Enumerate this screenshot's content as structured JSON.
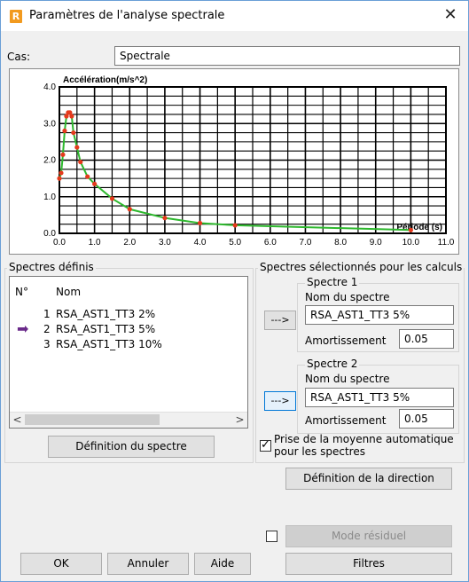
{
  "window": {
    "title": "Paramètres de l'analyse spectrale",
    "app_icon_letter": "R",
    "close_glyph": "✕"
  },
  "case": {
    "label": "Cas:",
    "value": "Spectrale"
  },
  "chart_data": {
    "type": "scatter",
    "title": "",
    "ylabel": "Accélération(m/s^2)",
    "xlabel": "Période (s)",
    "xlim": [
      0.0,
      11.0
    ],
    "ylim": [
      0.0,
      4.0
    ],
    "x_ticks": [
      "0.0",
      "1.0",
      "2.0",
      "3.0",
      "4.0",
      "5.0",
      "6.0",
      "7.0",
      "8.0",
      "9.0",
      "10.0",
      "11.0"
    ],
    "y_ticks": [
      "0.0",
      "1.0",
      "2.0",
      "3.0",
      "4.0"
    ],
    "grid": true,
    "series": [
      {
        "x": [
          0.0,
          0.05,
          0.1,
          0.15,
          0.2,
          0.25,
          0.3,
          0.35,
          0.4,
          0.5,
          0.6,
          0.8,
          1.0,
          1.5,
          2.0,
          3.0,
          4.0,
          5.0,
          10.0
        ],
        "y": [
          1.5,
          1.65,
          2.15,
          2.8,
          3.2,
          3.3,
          3.3,
          3.2,
          2.75,
          2.35,
          1.95,
          1.55,
          1.35,
          0.95,
          0.66,
          0.42,
          0.28,
          0.22,
          0.09
        ],
        "line_color": "#2eb82e",
        "marker_color": "#e53a1c"
      }
    ]
  },
  "left_panel": {
    "title": "Spectres définis",
    "columns": {
      "num": "N°",
      "name": "Nom"
    },
    "rows": [
      {
        "num": "1",
        "name": "RSA_AST1_TT3 2%",
        "selected": false
      },
      {
        "num": "2",
        "name": "RSA_AST1_TT3 5%",
        "selected": true
      },
      {
        "num": "3",
        "name": "RSA_AST1_TT3 10%",
        "selected": false
      }
    ],
    "scroll_left": "<",
    "scroll_right": ">",
    "definition_button": "Définition du spectre"
  },
  "right_panel": {
    "title": "Spectres sélectionnés pour les calculs",
    "spectre1": {
      "title": "Spectre 1",
      "name_label": "Nom du spectre",
      "name": "RSA_AST1_TT3 5%",
      "damping_label": "Amortissement",
      "damping": "0.05",
      "arrow": "--->"
    },
    "spectre2": {
      "title": "Spectre 2",
      "name_label": "Nom du spectre",
      "name": "RSA_AST1_TT3 5%",
      "damping_label": "Amortissement",
      "damping": "0.05",
      "arrow": "--->"
    },
    "average_checkbox": {
      "line1": "Prise de la moyenne automatique",
      "line2": "pour les spectres",
      "checked": true,
      "check_glyph": "✓"
    },
    "direction_button": "Définition de la direction"
  },
  "bottom": {
    "residual_checked": false,
    "residual_button": "Mode résiduel",
    "ok": "OK",
    "cancel": "Annuler",
    "help": "Aide",
    "filters": "Filtres"
  },
  "selected_row_arrow": "➡"
}
